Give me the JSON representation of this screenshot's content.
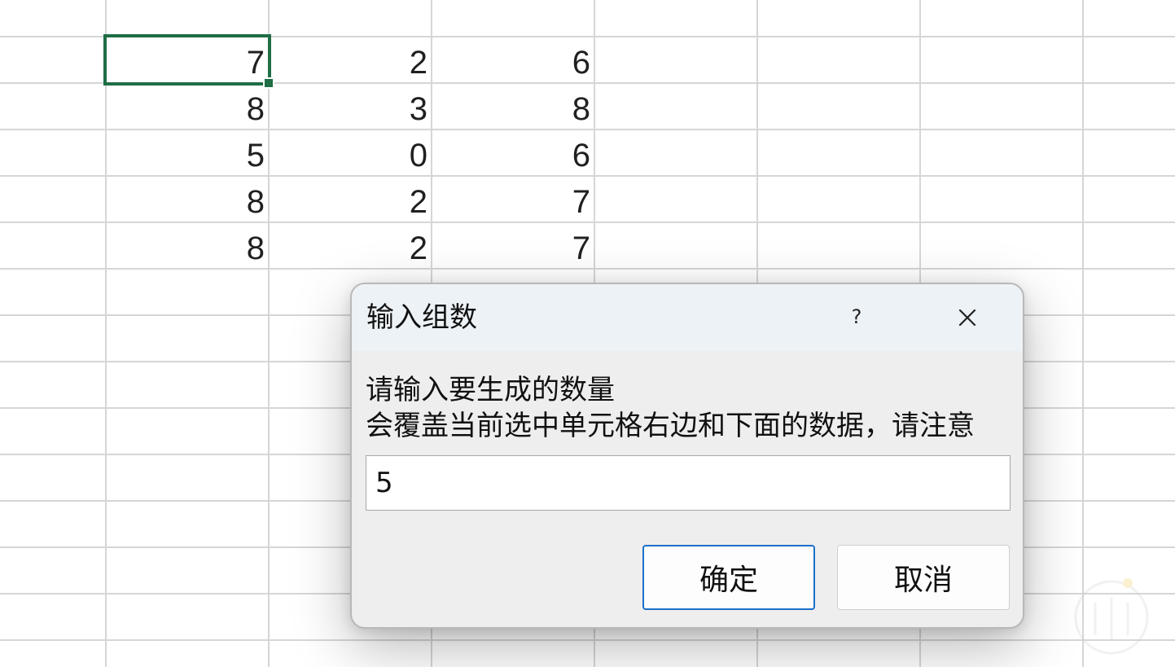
{
  "sheet": {
    "rows": [
      [
        "7",
        "2",
        "6"
      ],
      [
        "8",
        "3",
        "8"
      ],
      [
        "5",
        "0",
        "6"
      ],
      [
        "8",
        "2",
        "7"
      ],
      [
        "8",
        "2",
        "7"
      ]
    ]
  },
  "dialog": {
    "title": "输入组数",
    "help_label": "?",
    "close_icon": "close-icon",
    "prompt_line_1": "请输入要生成的数量",
    "prompt_line_2": "会覆盖当前选中单元格右边和下面的数据，请注意",
    "input_value": "5",
    "ok_label": "确定",
    "cancel_label": "取消"
  },
  "colors": {
    "selection": "#1e6e46",
    "gridline": "#d6d6d6",
    "ok_border": "#1a6fc9",
    "titlebar": "#edf2f6",
    "dialog_body": "#eeeeee"
  }
}
